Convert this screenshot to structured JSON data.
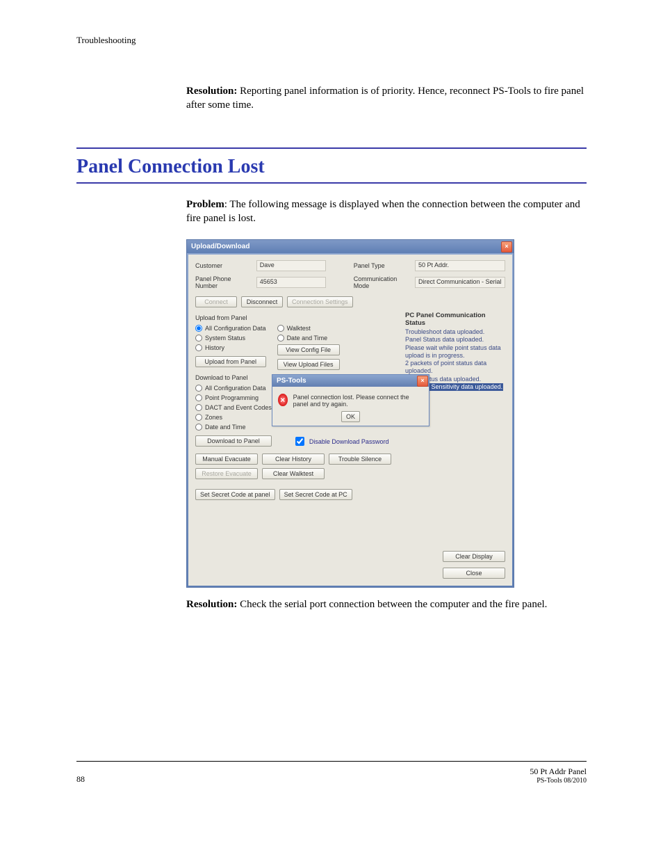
{
  "header": {
    "text": "Troubleshooting"
  },
  "resolution1": {
    "label": "Resolution:",
    "text": " Reporting panel information is of priority. Hence, reconnect PS-Tools to fire panel after some time."
  },
  "section_title": "Panel Connection Lost",
  "problem": {
    "label": "Problem",
    "text": ": The following message is displayed when the connection between the computer and fire panel is lost."
  },
  "resolution2": {
    "label": "Resolution:",
    "text": " Check the serial port connection between the computer and the fire panel."
  },
  "dialog": {
    "title": "Upload/Download",
    "info": {
      "customer_label": "Customer",
      "customer_value": "Dave",
      "phone_label": "Panel Phone Number",
      "phone_value": "45653",
      "panel_type_label": "Panel Type",
      "panel_type_value": "50 Pt Addr.",
      "comm_mode_label": "Communication Mode",
      "comm_mode_value": "Direct Communication - Serial"
    },
    "buttons": {
      "connect": "Connect",
      "disconnect": "Disconnect",
      "conn_settings": "Connection Settings",
      "view_config": "View Config File",
      "view_upload": "View Upload Files",
      "upload_panel": "Upload from Panel",
      "download_panel": "Download to Panel",
      "manual_evac": "Manual Evacuate",
      "restore_evac": "Restore Evacuate",
      "clear_history": "Clear History",
      "clear_walktest": "Clear Walktest",
      "trouble_silence": "Trouble Silence",
      "clear_display": "Clear Display",
      "close": "Close",
      "secret_panel": "Set Secret Code at panel",
      "secret_pc": "Set Secret Code at PC",
      "ok": "OK"
    },
    "upload": {
      "header": "Upload from Panel",
      "all_config": "All Configuration Data",
      "system_status": "System Status",
      "history": "History",
      "walktest": "Walktest",
      "date_time": "Date and Time"
    },
    "download": {
      "header": "Download to Panel",
      "all_config": "All Configuration Data",
      "point_prog": "Point Programming",
      "dact": "DACT and Event Codes",
      "zones": "Zones",
      "date_time": "Date and Time",
      "disable_pw": "Disable Download Password"
    },
    "status": {
      "header": "PC Panel Communication Status",
      "lines": [
        "Troubleshoot data uploaded.",
        "Panel Status data uploaded.",
        "Please wait while point status data upload is in progress.",
        "2 packets of point status data uploaded.",
        "Point status data uploaded."
      ],
      "highlight": "Detector Sensitivity data uploaded."
    },
    "alert": {
      "title": "PS-Tools",
      "message": "Panel connection lost. Please connect the panel and try again."
    }
  },
  "footer": {
    "page": "88",
    "right1": "50 Pt Addr Panel",
    "right2": "PS-Tools 08/2010"
  }
}
